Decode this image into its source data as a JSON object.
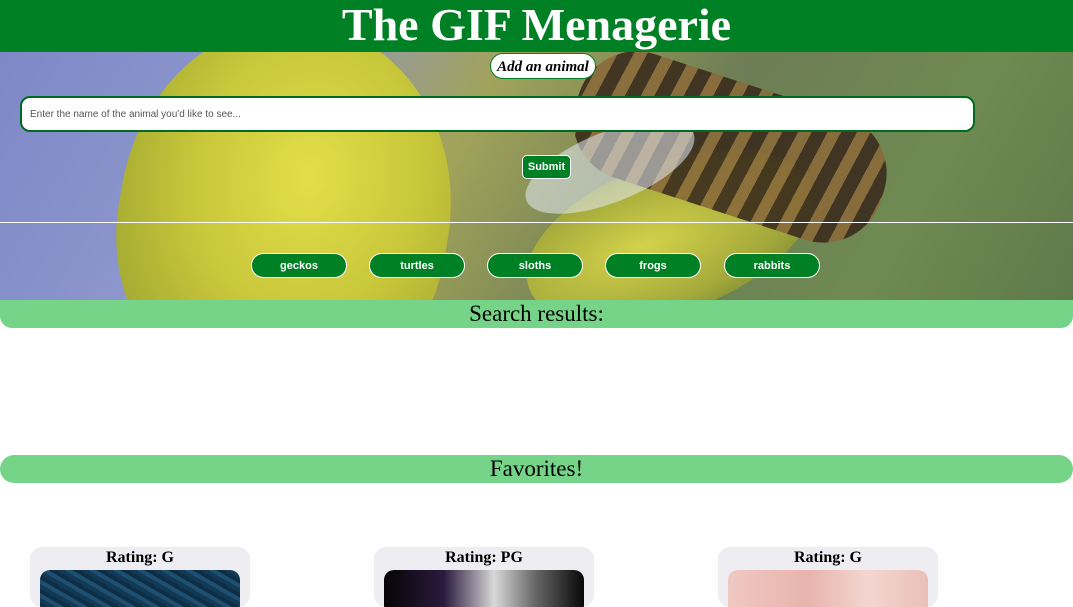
{
  "header": {
    "title": "The GIF Menagerie"
  },
  "add_form": {
    "label": "Add an animal",
    "input_placeholder": "Enter the name of the animal you'd like to see...",
    "submit_label": "Submit"
  },
  "animal_buttons": [
    "geckos",
    "turtles",
    "sloths",
    "frogs",
    "rabbits"
  ],
  "sections": {
    "search_results_title": "Search results:",
    "favorites_title": "Favorites!"
  },
  "favorites": [
    {
      "rating": "Rating: G"
    },
    {
      "rating": "Rating: PG"
    },
    {
      "rating": "Rating: G"
    }
  ],
  "colors": {
    "brand_green": "#008024",
    "section_green": "#76d488",
    "card_bg": "#eeeef2"
  }
}
